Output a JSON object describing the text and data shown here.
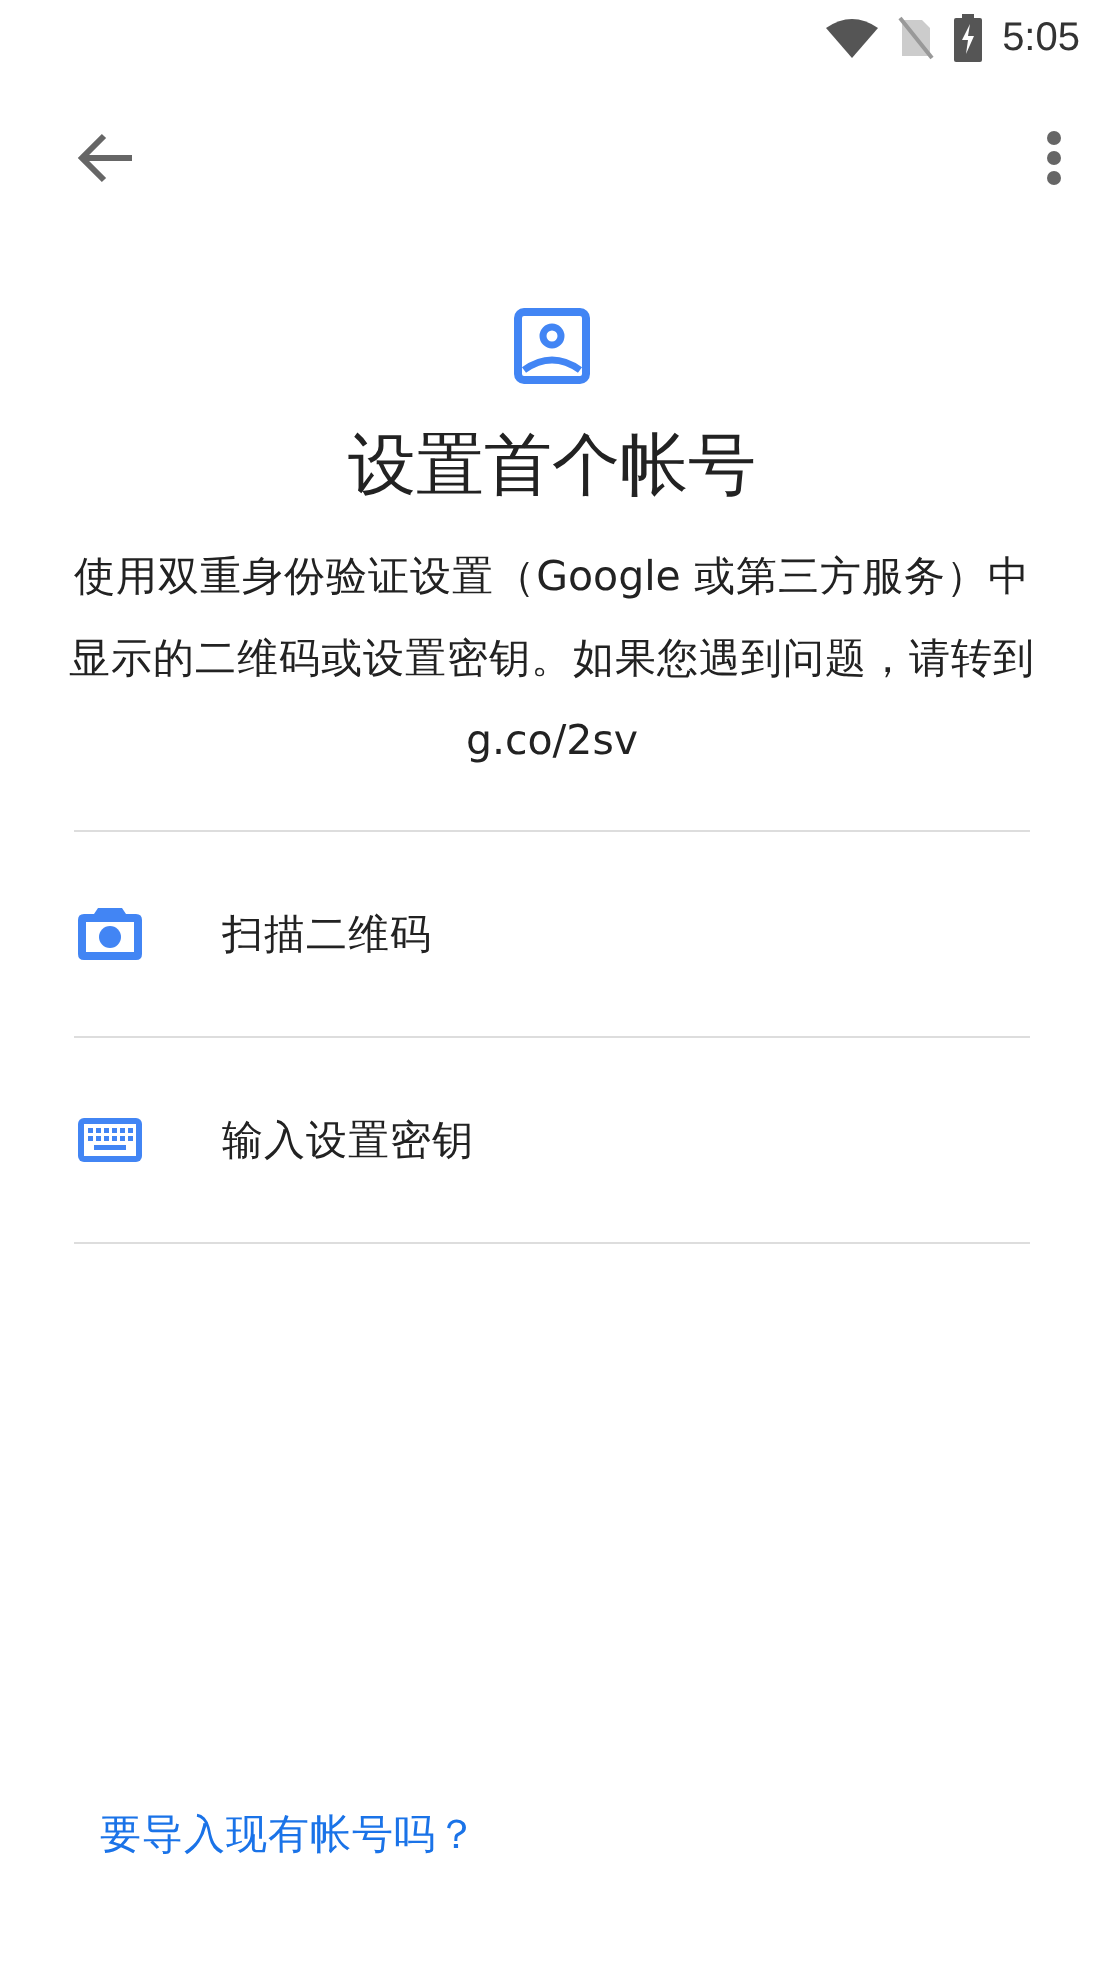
{
  "status_bar": {
    "time": "5:05"
  },
  "header": {
    "title": "设置首个帐号",
    "description": "使用双重身份验证设置（Google 或第三方服务）中显示的二维码或设置密钥。如果您遇到问题，请转到 g.co/2sv"
  },
  "options": [
    {
      "kind": "camera",
      "label": "扫描二维码"
    },
    {
      "kind": "keyboard",
      "label": "输入设置密钥"
    }
  ],
  "footer_link": "要导入现有帐号吗？"
}
